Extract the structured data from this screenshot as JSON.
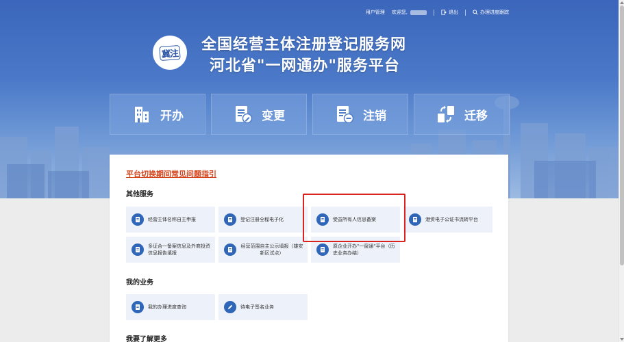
{
  "topbar": {
    "user_manage": "用户管理",
    "welcome": "欢迎您,",
    "logout": "退出",
    "progress_track": "办理进度跟踪"
  },
  "logo": {
    "text": "冀注"
  },
  "header": {
    "title_line1": "全国经营主体注册登记服务网",
    "title_line2": "河北省\"一网通办\"服务平台"
  },
  "main_tabs": [
    {
      "label": "开办",
      "icon": "building-icon"
    },
    {
      "label": "变更",
      "icon": "doc-edit-icon"
    },
    {
      "label": "注销",
      "icon": "doc-cancel-icon"
    },
    {
      "label": "迁移",
      "icon": "transfer-icon"
    }
  ],
  "faq_link": "平台切换期间常见问题指引",
  "sections": {
    "other_services": "其他服务",
    "my_business": "我的业务",
    "learn_more": "我要了解更多"
  },
  "other_services": [
    {
      "label": "经营主体名称自主申报",
      "icon": "document-icon"
    },
    {
      "label": "登记注册全程电子化",
      "icon": "document-icon"
    },
    {
      "label": "受益所有人信息备案",
      "icon": "document-icon"
    },
    {
      "label": "港资电子公证书流转平台",
      "icon": "document-icon"
    },
    {
      "label": "多证合一备案信息及外商投资信息报告填报",
      "icon": "document-icon"
    },
    {
      "label": "经营范围自主公示填报（雄安新区试点）",
      "icon": "document-icon"
    },
    {
      "label": "原企业开办\"一窗通\"平台（历史业务办结）",
      "icon": "document-icon"
    }
  ],
  "my_business": [
    {
      "label": "我的办理进度查询",
      "icon": "document-icon"
    },
    {
      "label": "待电子签名业务",
      "icon": "pen-icon"
    }
  ],
  "colors": {
    "accent": "#2f66b8",
    "faq_link": "#d4441c",
    "highlight_border": "#d8231f",
    "tile_bg": "#edf2fa"
  }
}
